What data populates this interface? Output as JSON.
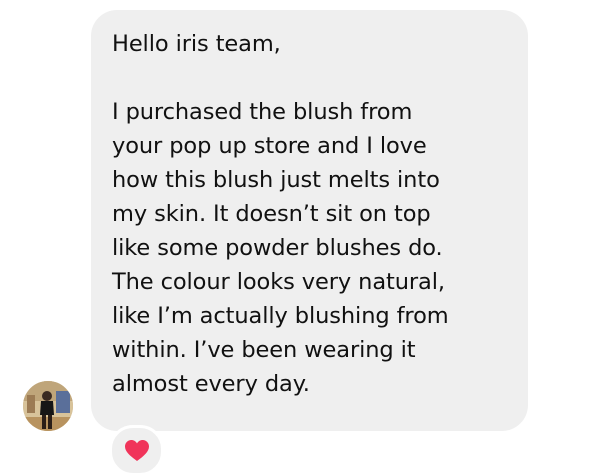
{
  "message": {
    "greeting": "Hello iris team,",
    "lines": [
      "I purchased the blush from",
      "your pop up store and I love",
      "how this blush just melts into",
      "my skin. It doesn’t sit on top",
      "like some powder blushes do.",
      "The colour looks very natural,",
      "like I’m actually blushing from",
      "within. I’ve been wearing it",
      "almost every day."
    ]
  },
  "reaction": {
    "icon": "heart-icon",
    "color": "#f0345a"
  },
  "avatar": {
    "icon": "sender-avatar"
  }
}
